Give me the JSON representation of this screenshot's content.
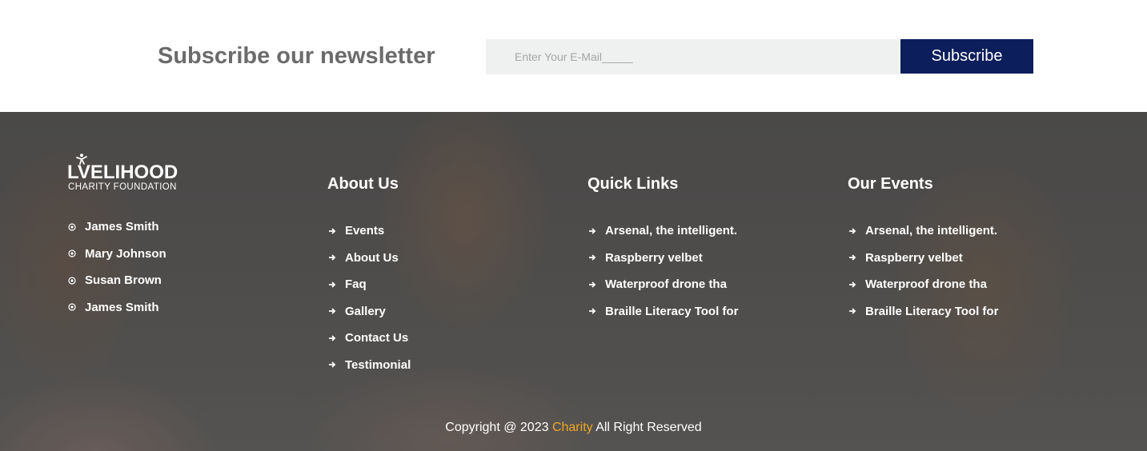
{
  "newsletter": {
    "title": "Subscribe our newsletter",
    "email_placeholder": "Enter Your E-Mail_____",
    "email_value": "",
    "subscribe_label": "Subscribe"
  },
  "logo": {
    "main": "LVELIHOOD",
    "sub": "CHARITY FOUNDATION",
    "icon": "person-figure-icon"
  },
  "contacts": {
    "bullet_icon": "circle-dot-icon",
    "items": [
      {
        "label": "James Smith"
      },
      {
        "label": "Mary Johnson"
      },
      {
        "label": "Susan Brown"
      },
      {
        "label": "James Smith"
      }
    ]
  },
  "about": {
    "heading": "About Us",
    "bullet_icon": "arrow-right-icon",
    "items": [
      {
        "label": "Events"
      },
      {
        "label": "About Us"
      },
      {
        "label": "Faq"
      },
      {
        "label": "Gallery"
      },
      {
        "label": "Contact Us"
      },
      {
        "label": "Testimonial"
      }
    ]
  },
  "quick_links": {
    "heading": "Quick Links",
    "bullet_icon": "arrow-right-icon",
    "items": [
      {
        "label": "Arsenal, the intelligent."
      },
      {
        "label": "Raspberry velbet"
      },
      {
        "label": "Waterproof drone tha"
      },
      {
        "label": "Braille Literacy Tool for"
      }
    ]
  },
  "our_events": {
    "heading": "Our Events",
    "bullet_icon": "arrow-right-icon",
    "items": [
      {
        "label": "Arsenal, the intelligent."
      },
      {
        "label": "Raspberry velbet"
      },
      {
        "label": "Waterproof drone tha"
      },
      {
        "label": "Braille Literacy Tool for"
      }
    ]
  },
  "copyright": {
    "prefix": "Copyright @ 2023 ",
    "brand": "Charity",
    "suffix": " All Right Reserved"
  },
  "colors": {
    "subscribe_button": "#0c1e5b",
    "input_background": "#eff1f0",
    "newsletter_title": "#6b6b6b",
    "brand_accent": "#f2a623",
    "footer_text": "#ffffff"
  }
}
